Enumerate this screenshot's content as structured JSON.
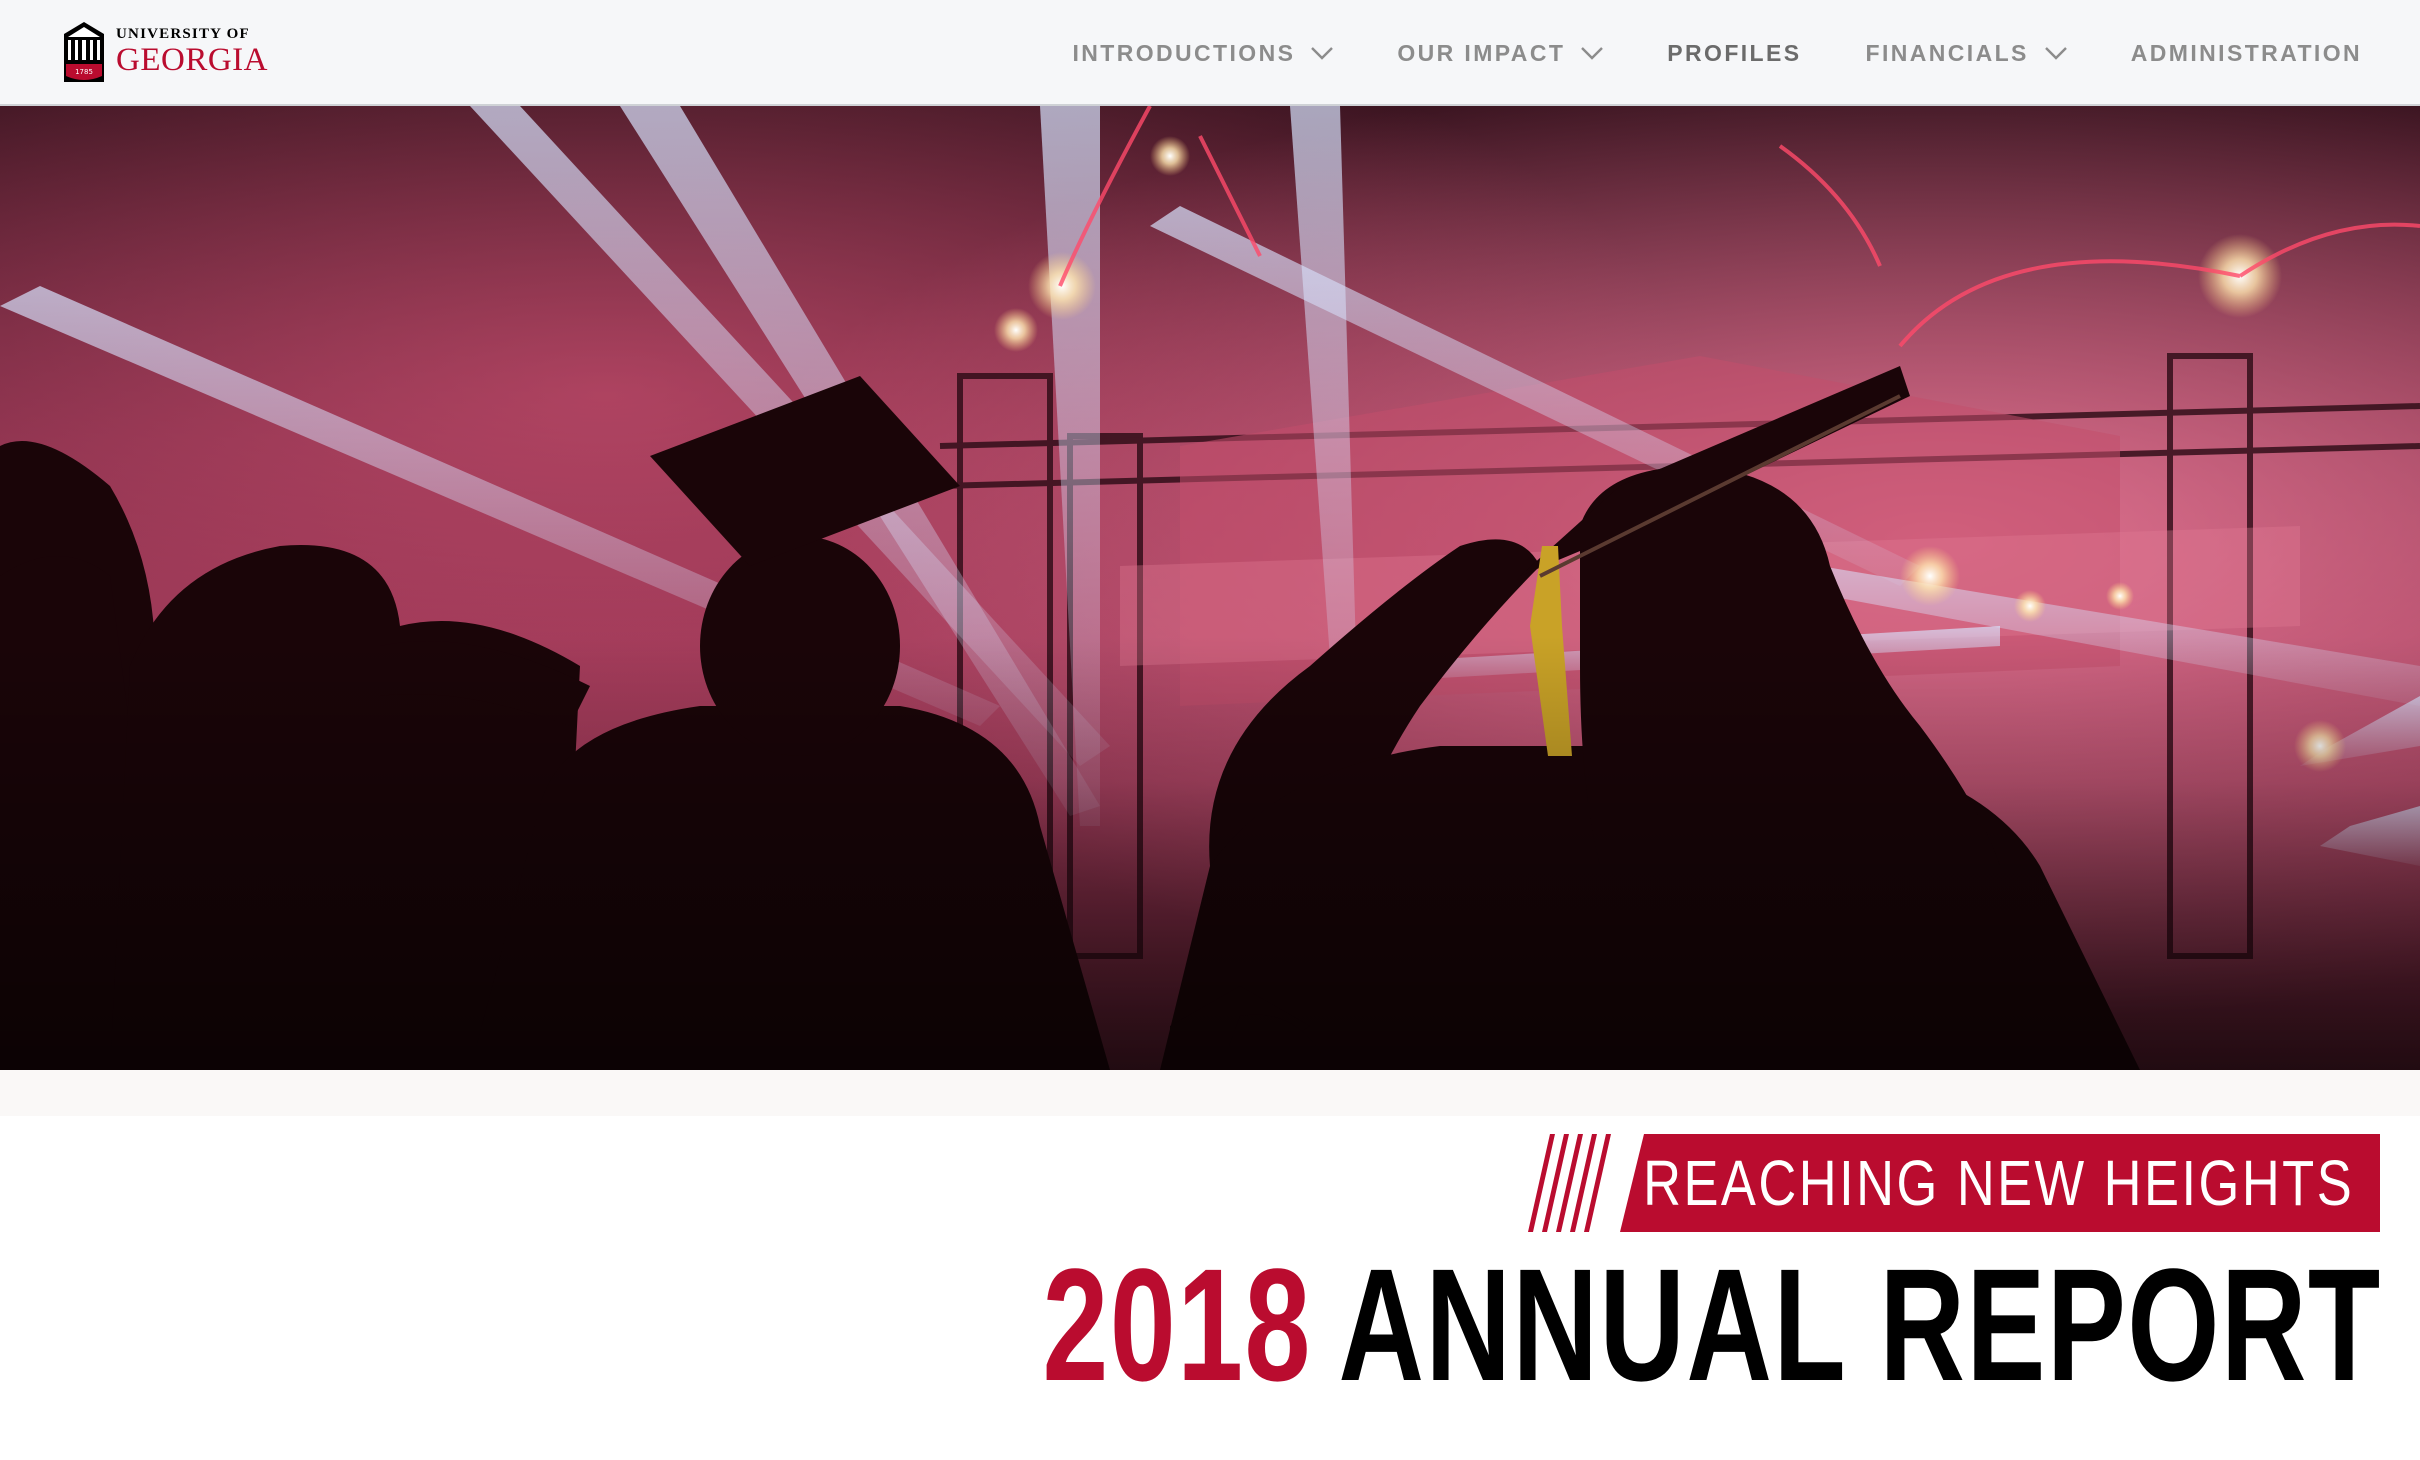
{
  "header": {
    "logo": {
      "line1": "UNIVERSITY OF",
      "line2": "GEORGIA",
      "seal_year": "1785",
      "brand_color": "#ba0c2f"
    },
    "nav": [
      {
        "label": "INTRODUCTIONS",
        "has_dropdown": true
      },
      {
        "label": "OUR IMPACT",
        "has_dropdown": true
      },
      {
        "label": "PROFILES",
        "has_dropdown": false
      },
      {
        "label": "FINANCIALS",
        "has_dropdown": true
      },
      {
        "label": "ADMINISTRATION",
        "has_dropdown": false
      }
    ]
  },
  "hero": {
    "subject": "graduates-in-caps-and-gowns-watching-fireworks-and-stage-lights"
  },
  "title": {
    "tagline": "REACHING NEW HEIGHTS",
    "year": "2018",
    "headline": "ANNUAL REPORT"
  },
  "colors": {
    "accent_red": "#ba0c2f",
    "nav_text": "#8c8c8c",
    "header_bg": "#f6f7f9"
  },
  "icons": {
    "dropdown": "chevron-down-icon",
    "logo": "arch-icon"
  }
}
